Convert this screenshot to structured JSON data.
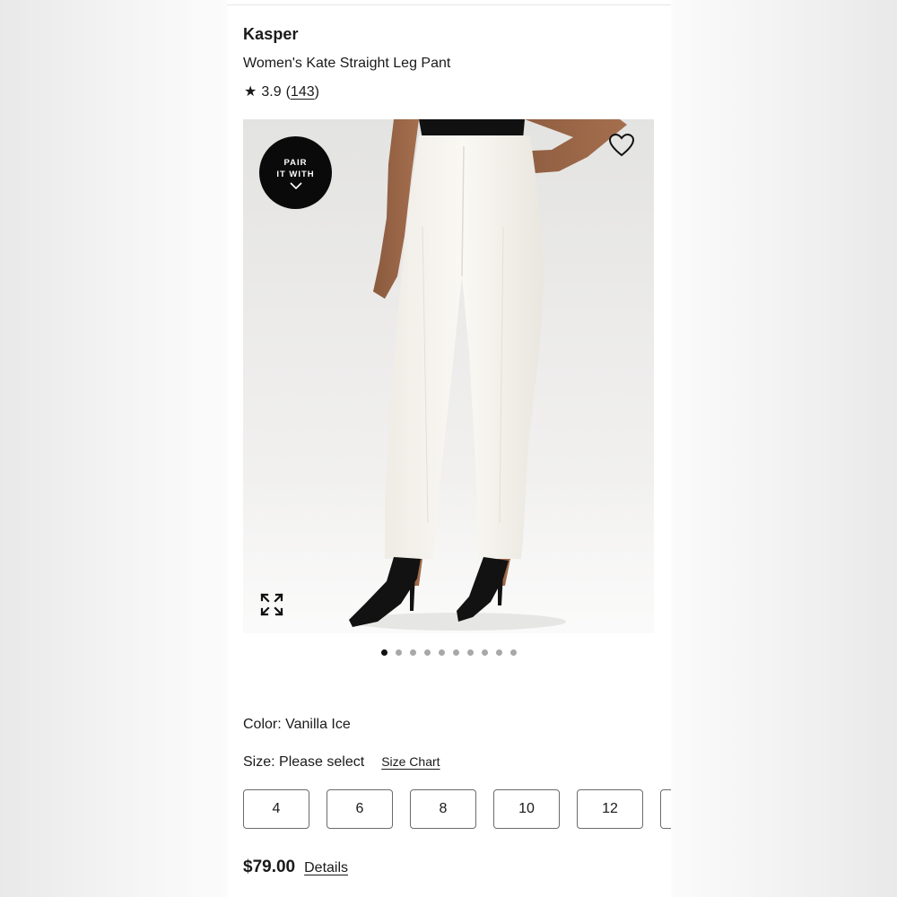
{
  "product": {
    "brand": "Kasper",
    "name": "Women's Kate Straight Leg Pant",
    "rating": "3.9",
    "review_count_open": "(",
    "review_count": "143",
    "review_count_close": ")"
  },
  "hero": {
    "badge_line1": "PAIR",
    "badge_line2": "IT WITH",
    "icons": {
      "favorite": "heart-icon",
      "expand": "expand-icon",
      "badge_chevron": "chevron-down-icon"
    }
  },
  "carousel": {
    "total": 10,
    "active_index": 0
  },
  "color": {
    "label": "Color: Vanilla Ice"
  },
  "size": {
    "label": "Size: Please select",
    "chart_link": "Size Chart",
    "options": [
      "4",
      "6",
      "8",
      "10",
      "12"
    ]
  },
  "price": {
    "amount": "$79.00",
    "details_link": "Details"
  },
  "colors": {
    "badge_bg": "#0a0a0a",
    "dot_active": "#111111",
    "dot_inactive": "#a8a8a8",
    "button_border": "#6b6b6b"
  }
}
